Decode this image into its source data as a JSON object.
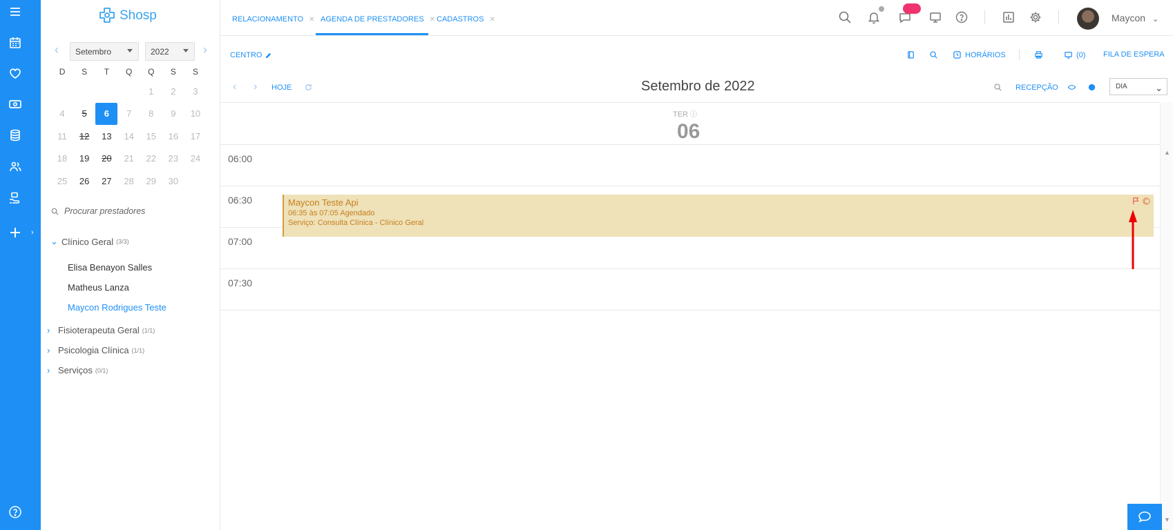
{
  "app": {
    "brand": "Shosp"
  },
  "rail": {
    "items": [
      "menu-icon",
      "calendar-icon",
      "heart-icon",
      "money-icon",
      "database-icon",
      "user-group-icon",
      "hand-icon",
      "add-icon",
      "help-icon"
    ]
  },
  "tabs": [
    {
      "label": "RELACIONAMENTO"
    },
    {
      "label": "AGENDA DE PRESTADORES"
    },
    {
      "label": "CADASTROS"
    }
  ],
  "header": {
    "user_name": "Maycon"
  },
  "mini_calendar": {
    "month": "Setembro",
    "year": "2022",
    "weekdays": [
      "D",
      "S",
      "T",
      "Q",
      "Q",
      "S",
      "S"
    ],
    "weeks": [
      [
        "",
        "",
        "",
        "",
        "1",
        "2",
        "3"
      ],
      [
        "4",
        "5",
        "6",
        "7",
        "8",
        "9",
        "10"
      ],
      [
        "11",
        "12",
        "13",
        "14",
        "15",
        "16",
        "17"
      ],
      [
        "18",
        "19",
        "20",
        "21",
        "22",
        "23",
        "24"
      ],
      [
        "25",
        "26",
        "27",
        "28",
        "29",
        "30",
        ""
      ]
    ],
    "selected": "6",
    "struck": [
      "5",
      "12",
      "20"
    ],
    "dark": [
      "13",
      "19",
      "26",
      "27"
    ]
  },
  "provider_search": {
    "placeholder": "Procurar prestadores"
  },
  "groups": [
    {
      "name": "Clínico Geral",
      "count": "(3/3)",
      "expanded": true,
      "providers": [
        "Elisa Benayon Salles",
        "Matheus Lanza",
        "Maycon Rodrigues Teste"
      ]
    },
    {
      "name": "Fisioterapeuta Geral",
      "count": "(1/1)",
      "expanded": false
    },
    {
      "name": "Psicologia Clínica",
      "count": "(1/1)",
      "expanded": false
    },
    {
      "name": "Serviços",
      "count": "(0/1)",
      "expanded": false
    }
  ],
  "toolbar": {
    "centro": "CENTRO",
    "horarios": "HORÁRIOS",
    "queue_count": "(0)",
    "fila": "FILA DE ESPERA",
    "hoje": "HOJE",
    "month_title": "Setembro de 2022",
    "recepcao": "RECEPÇÃO",
    "view": "DIA"
  },
  "day_header": {
    "weekday": "TER",
    "day": "06"
  },
  "time_slots": [
    "06:00",
    "06:30",
    "07:00",
    "07:30"
  ],
  "event": {
    "title": "Maycon Teste Api",
    "time_status": "06:35 às 07:05 Agendado",
    "service": "Serviço: Consulta Clínica - Clínico Geral"
  },
  "colors": {
    "primary": "#1e90f5",
    "event_bg": "#efe1b8",
    "event_text": "#c57f1e",
    "badge": "#f0336e",
    "arrow": "#ee0000"
  }
}
